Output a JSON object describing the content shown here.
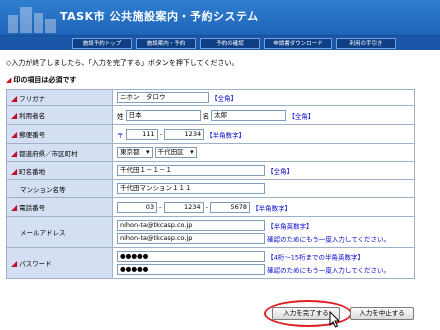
{
  "header": {
    "title": "TASK市  公共施設案内・予約システム"
  },
  "tabs": [
    {
      "label": "施設予約トップ"
    },
    {
      "label": "施設案内・予約"
    },
    {
      "label": "予約の確認"
    },
    {
      "label": "申請書ダウンロード"
    },
    {
      "label": "利用の手引き"
    }
  ],
  "instruction": "◇入力が終了しましたら、「入力を完了する」ボタンを押下してください。",
  "required_note": {
    "mark": "◢",
    "text": "印の項目は必須です"
  },
  "form": {
    "furigana": {
      "label": "フリガナ",
      "value": "ニホン　タロウ",
      "hint": "【全角】"
    },
    "name": {
      "label": "利用者名",
      "sei_label": "姓",
      "sei_value": "日本",
      "mei_label": "名",
      "mei_value": "太郎",
      "hint": "【全角】"
    },
    "postal": {
      "label": "郵便番号",
      "prefix": "〒",
      "part1": "111",
      "part2": "1234",
      "hint": "【半角数字】"
    },
    "pref_city": {
      "label": "都道府県／市区町村",
      "pref": "東京都",
      "city": "千代田区"
    },
    "town": {
      "label": "町名番地",
      "value": "千代田１－１－１",
      "hint": "【全角】"
    },
    "building": {
      "label": "マンション名等",
      "value": "千代田マンション１１１"
    },
    "phone": {
      "label": "電話番号",
      "part1": "03",
      "part2": "1234",
      "part3": "5678",
      "hint": "【半角数字】"
    },
    "email": {
      "label": "メールアドレス",
      "value": "nihon-ta@tkcasp.co.jp",
      "hint": "【半角英数字】",
      "confirm_value": "nihon-ta@tkcasp.co.jp",
      "confirm_hint": "確認のためにもう一度入力してください。"
    },
    "password": {
      "label": "パスワード",
      "value": "●●●●●",
      "hint": "【4桁～15桁までの半角英数字】",
      "confirm_value": "●●●●●",
      "confirm_hint": "確認のためにもう一度入力してください。"
    }
  },
  "buttons": {
    "complete": "入力を完了する",
    "cancel": "入力を中止する"
  },
  "colors": {
    "header": "#1f63b8",
    "label_bg": "#d4dff3",
    "hint": "#0000cc",
    "required": "#c0102a",
    "highlight_ring": "#e02020"
  }
}
